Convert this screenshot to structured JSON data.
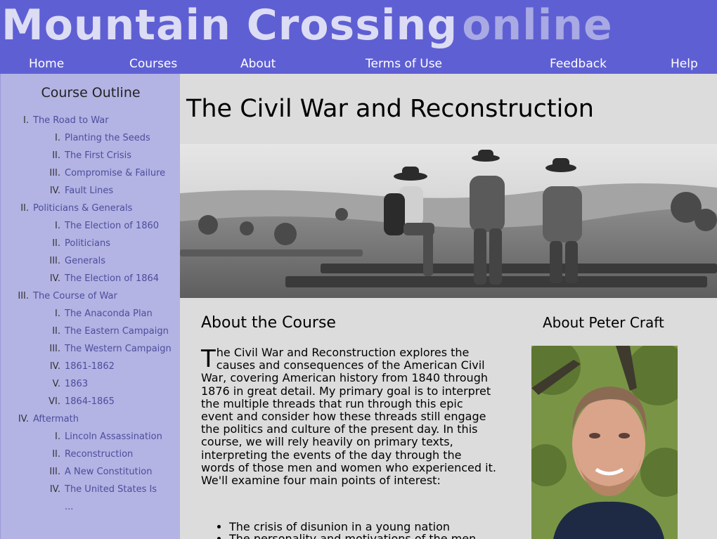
{
  "header": {
    "logo_main": "Mountain Crossing",
    "logo_accent": "online",
    "nav": [
      "Home",
      "Courses",
      "About",
      "Terms of Use",
      "Feedback",
      "Help"
    ]
  },
  "sidebar": {
    "title": "Course Outline",
    "units": [
      {
        "num": "I.",
        "label": "The Road to War",
        "items": [
          {
            "num": "I.",
            "label": "Planting the Seeds"
          },
          {
            "num": "II.",
            "label": "The First Crisis"
          },
          {
            "num": "III.",
            "label": "Compromise & Failure"
          },
          {
            "num": "IV.",
            "label": "Fault Lines"
          }
        ]
      },
      {
        "num": "II.",
        "label": "Politicians & Generals",
        "items": [
          {
            "num": "I.",
            "label": "The Election of 1860"
          },
          {
            "num": "II.",
            "label": "Politicians"
          },
          {
            "num": "III.",
            "label": "Generals"
          },
          {
            "num": "IV.",
            "label": "The Election of 1864"
          }
        ]
      },
      {
        "num": "III.",
        "label": "The Course of War",
        "items": [
          {
            "num": "I.",
            "label": "The Anaconda Plan"
          },
          {
            "num": "II.",
            "label": "The Eastern Campaign"
          },
          {
            "num": "III.",
            "label": "The Western Campaign"
          },
          {
            "num": "IV.",
            "label": "1861-1862"
          },
          {
            "num": "V.",
            "label": "1863"
          },
          {
            "num": "VI.",
            "label": "1864-1865"
          }
        ]
      },
      {
        "num": "IV.",
        "label": "Aftermath",
        "items": [
          {
            "num": "I.",
            "label": "Lincoln Assassination"
          },
          {
            "num": "II.",
            "label": "Reconstruction"
          },
          {
            "num": "III.",
            "label": "A New Constitution"
          },
          {
            "num": "IV.",
            "label": "The United States Is"
          },
          {
            "num": "",
            "label": "..."
          }
        ]
      }
    ]
  },
  "main": {
    "title": "The Civil War and Reconstruction",
    "about_heading": "About the Course",
    "about_dropcap": "T",
    "about_text": "he Civil War and Reconstruction explores the causes and consequences of the American Civil War, covering American history from 1840 through 1876 in great detail. My primary goal is to interpret the multiple threads that run through this epic event and consider how these threads still engage the politics and culture of the present day. In this course, we will rely heavily on primary texts, interpreting the events of the day through the words of those men and women who experienced it. We'll examine four main points of interest:",
    "topics": [
      "The crisis of disunion in a young nation",
      "The personality and motivations of the men"
    ],
    "instructor_heading": "About Peter Craft"
  },
  "colors": {
    "header_bg": "#5f5fd4",
    "sidebar_bg": "#b3b3e4",
    "page_bg": "#dcdcdc",
    "link": "#4d4d9c"
  },
  "icons": {
    "banner": "civil-war-soldiers-photo",
    "portrait": "instructor-portrait-photo"
  }
}
